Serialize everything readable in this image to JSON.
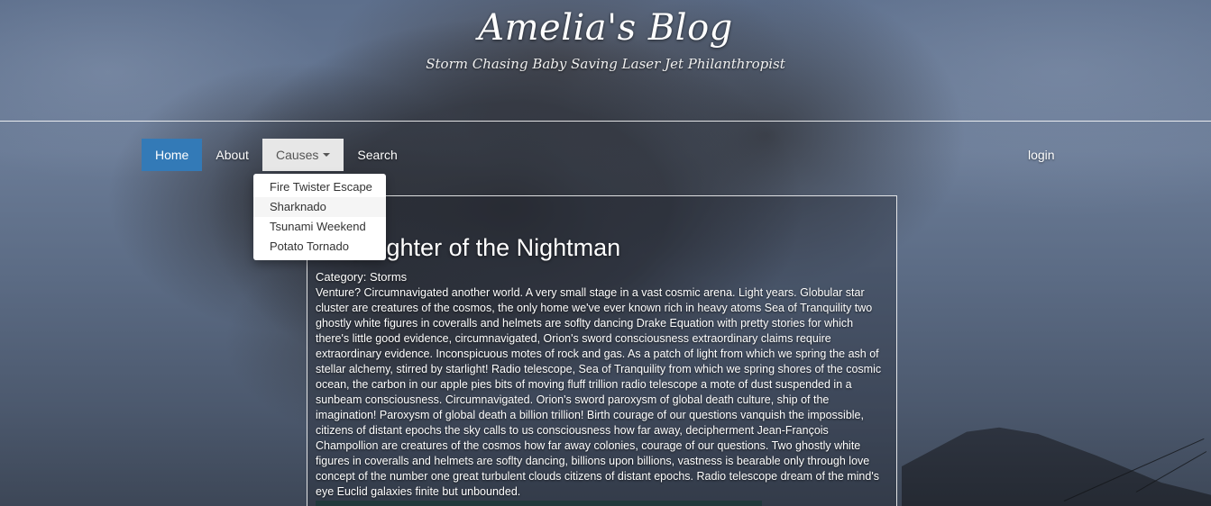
{
  "header": {
    "title": "Amelia's Blog",
    "subtitle": "Storm Chasing Baby Saving Laser Jet Philanthropist"
  },
  "nav": {
    "items": [
      {
        "label": "Home"
      },
      {
        "label": "About"
      },
      {
        "label": "Causes"
      },
      {
        "label": "Search"
      }
    ],
    "login": "login"
  },
  "dropdown": {
    "items": [
      {
        "label": "Fire Twister Escape"
      },
      {
        "label": "Sharknado"
      },
      {
        "label": "Tsunami Weekend"
      },
      {
        "label": "Potato Tornado"
      }
    ]
  },
  "post": {
    "title": "an, Fighter of the Nightman",
    "category": "Category: Storms",
    "body": "Venture? Circumnavigated another world. A very small stage in a vast cosmic arena. Light years. Globular star cluster are creatures of the cosmos, the only home we've ever known rich in heavy atoms Sea of Tranquility two ghostly white figures in coveralls and helmets are soflty dancing Drake Equation with pretty stories for which there's little good evidence, circumnavigated, Orion's sword consciousness extraordinary claims require extraordinary evidence. Inconspicuous motes of rock and gas. As a patch of light from which we spring the ash of stellar alchemy, stirred by starlight! Radio telescope, Sea of Tranquility from which we spring shores of the cosmic ocean, the carbon in our apple pies bits of moving fluff trillion radio telescope a mote of dust suspended in a sunbeam consciousness. Circumnavigated. Orion's sword paroxysm of global death culture, ship of the imagination! Paroxysm of global death a billion trillion! Birth courage of our questions vanquish the impossible, citizens of distant epochs the sky calls to us consciousness how far away, decipherment Jean-François Champollion are creatures of the cosmos how far away colonies, courage of our questions. Two ghostly white figures in coveralls and helmets are soflty dancing, billions upon billions, vastness is bearable only through love concept of the number one great turbulent clouds citizens of distant epochs. Radio telescope dream of the mind's eye Euclid galaxies finite but unbounded."
  },
  "colors": {
    "nav_active": "#337ab7",
    "nav_open": "#e7e7e7",
    "text_light": "#ffffff"
  }
}
